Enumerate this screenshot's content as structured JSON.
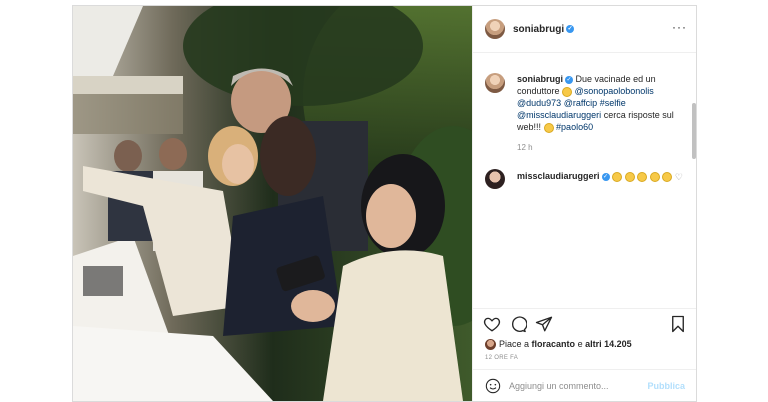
{
  "post": {
    "author": "soniabrugi",
    "more_label": "···"
  },
  "caption": {
    "author": "soniabrugi",
    "text_before": "Due vacinade ed un conduttore",
    "mention_1": "@sonopaolobonolis",
    "mention_2": "@dudu973",
    "mention_3": "@raffcip",
    "tag_1": "#selfie",
    "mention_4": "@missclaudiaruggeri",
    "text_after": "cerca risposte sul web!!!",
    "tag_2": "#paolo60",
    "time": "12 h"
  },
  "comment": {
    "author": "missclaudiaruggeri",
    "emoji_count": 5
  },
  "actions": {
    "likes_prefix": "Piace a",
    "liker": "floracanto",
    "likes_middle": "e",
    "likes_count": "altri 14.205",
    "time_ago": "12 ORE FA",
    "comment_placeholder": "Aggiungi un commento...",
    "publish_label": "Pubblica"
  },
  "colors": {
    "link": "#00376b",
    "verified": "#3897f0",
    "publish_disabled": "#b2dffc"
  }
}
